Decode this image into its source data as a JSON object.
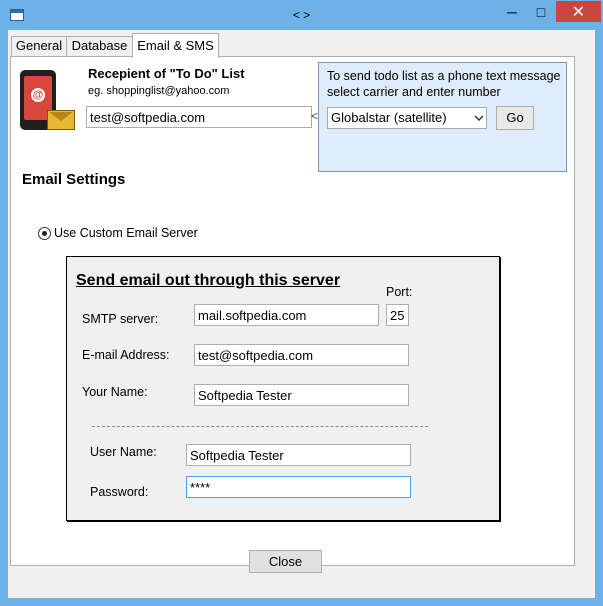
{
  "window": {
    "title": "< >",
    "minimize": "─",
    "maximize": "□",
    "close": "✕"
  },
  "tabs": [
    {
      "label": "General"
    },
    {
      "label": "Database"
    },
    {
      "label": "Email & SMS"
    }
  ],
  "recipient": {
    "title": "Recepient of \"To Do\" List",
    "example": "eg. shoppinglist@yahoo.com",
    "value": "test@softpedia.com",
    "arrow": "<"
  },
  "sms": {
    "text": "To send todo list as a phone text message select carrier and enter number",
    "carrier": "Globalstar (satellite)",
    "go_label": "Go"
  },
  "email_settings": {
    "heading": "Email Settings",
    "radio_label": "Use Custom Email Server"
  },
  "server": {
    "title": "Send email out through this server",
    "port_label": "Port:",
    "port_value": "25",
    "smtp_label": "SMTP server:",
    "smtp_value": "mail.softpedia.com",
    "email_label": "E-mail Address:",
    "email_value": "test@softpedia.com",
    "name_label": "Your Name:",
    "name_value": "Softpedia Tester",
    "username_label": "User Name:",
    "username_value": "Softpedia Tester",
    "password_label": "Password:",
    "password_value": "****"
  },
  "footer": {
    "close_label": "Close"
  },
  "icons": {
    "app": "window-icon",
    "phone": "phone-email-icon",
    "dropdown": "chevron-down-icon"
  }
}
